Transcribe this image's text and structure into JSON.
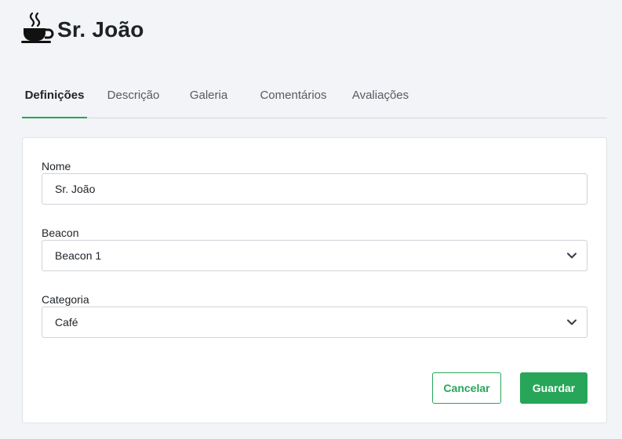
{
  "header": {
    "title": "Sr. João",
    "icon": "coffee-cup-icon"
  },
  "tabs": [
    {
      "label": "Definições",
      "active": true
    },
    {
      "label": "Descrição",
      "active": false
    },
    {
      "label": "Galeria",
      "active": false
    },
    {
      "label": "Comentários",
      "active": false
    },
    {
      "label": "Avaliações",
      "active": false
    }
  ],
  "form": {
    "nome": {
      "label": "Nome",
      "value": "Sr. João"
    },
    "beacon": {
      "label": "Beacon",
      "value": "Beacon 1"
    },
    "categoria": {
      "label": "Categoria",
      "value": "Café"
    }
  },
  "actions": {
    "cancel_label": "Cancelar",
    "save_label": "Guardar"
  },
  "colors": {
    "accent": "#27a558",
    "background": "#f2f4f7"
  }
}
